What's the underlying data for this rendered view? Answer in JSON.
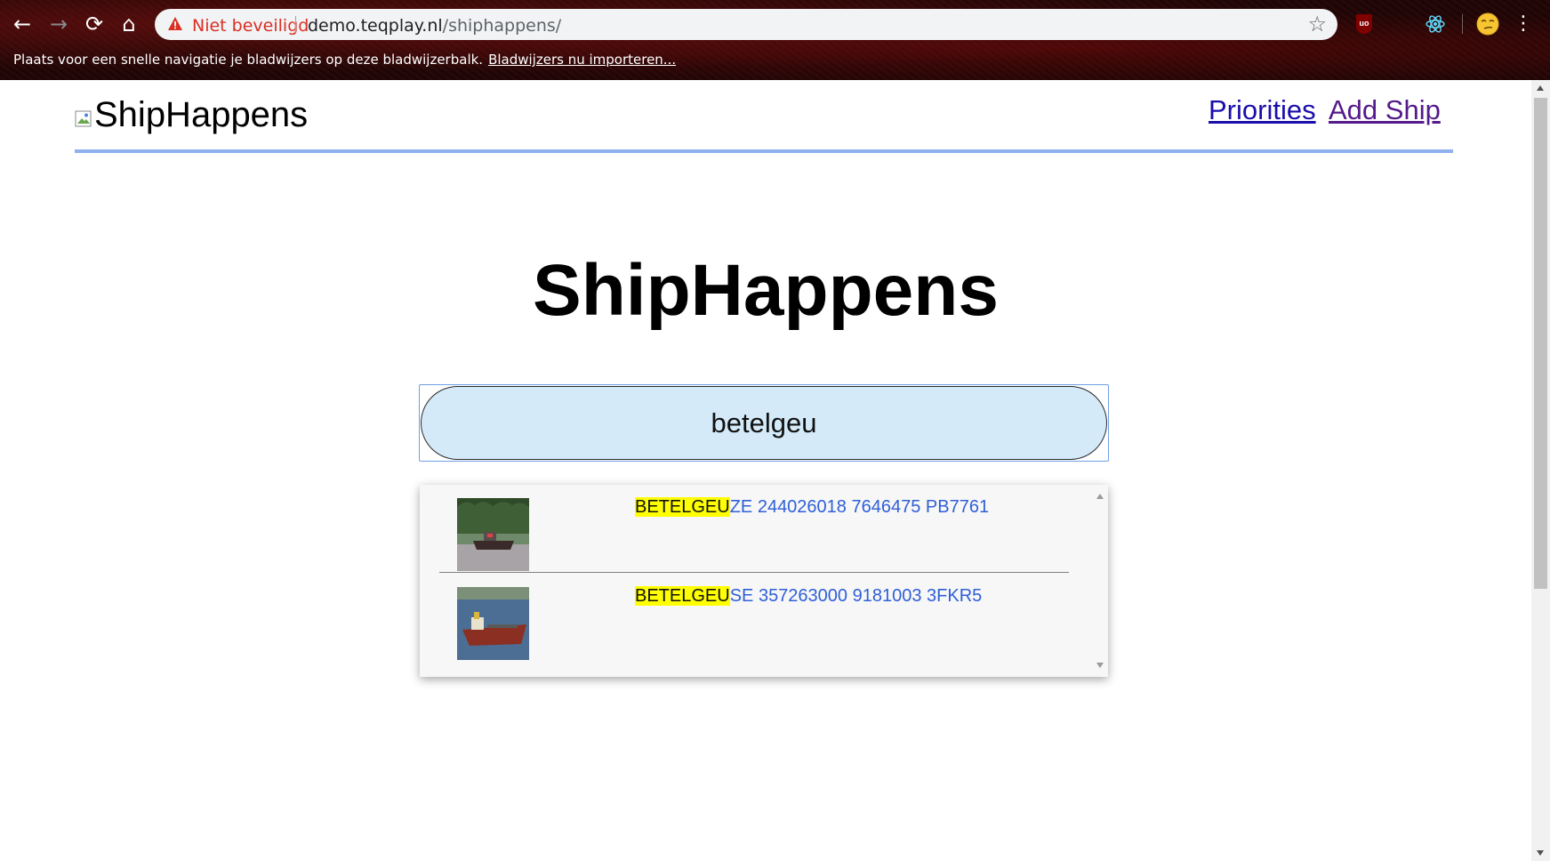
{
  "browser": {
    "back_icon": "arrow-left",
    "forward_icon": "arrow-right",
    "reload_icon": "reload",
    "home_icon": "home",
    "security_label": "Niet beveiligd",
    "url_host": "demo.teqplay.nl",
    "url_path": "/shiphappens/",
    "bookmark_bar_text": "Plaats voor een snelle navigatie je bladwijzers op deze bladwijzerbalk.",
    "bookmark_bar_link": "Bladwijzers nu importeren...",
    "extensions": [
      "ublock-icon",
      "react-devtools-icon",
      "emoji-avatar-icon"
    ]
  },
  "header": {
    "brand": "ShipHappens",
    "nav": [
      {
        "label": "Priorities"
      },
      {
        "label": "Add Ship"
      }
    ]
  },
  "main": {
    "title": "ShipHappens",
    "search": {
      "value": "betelgeu"
    },
    "results": [
      {
        "highlight": "BETELGEU",
        "rest": "ZE 244026018 7646475 PB7761",
        "image": "tugboat-photo"
      },
      {
        "highlight": "BETELGEU",
        "rest": "SE 357263000 9181003 3FKR5",
        "image": "cargo-ship-photo"
      }
    ]
  },
  "colors": {
    "accent_rule": "#8fb1ee",
    "search_bg": "#d4eaf8",
    "highlight": "#ffff00",
    "result_text": "#2f5fd7"
  }
}
